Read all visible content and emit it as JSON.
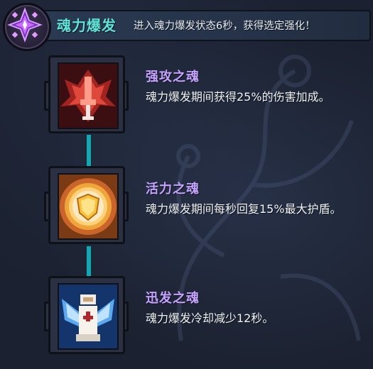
{
  "header": {
    "title": "魂力爆发",
    "subtitle": "进入魂力爆发状态6秒，获得选定强化！",
    "emblem_icon": "purple-crystal-icon"
  },
  "skills": [
    {
      "name": "强攻之魂",
      "description": "魂力爆发期间获得25%的伤害加成。",
      "icon": "red-flame-sword-icon",
      "accent": "#c33a2c"
    },
    {
      "name": "活力之魂",
      "description": "魂力爆发期间每秒回复15%最大护盾。",
      "icon": "golden-shield-icon",
      "accent": "#f0a53a"
    },
    {
      "name": "迅发之魂",
      "description": "魂力爆发冷却减少12秒。",
      "icon": "winged-angel-icon",
      "accent": "#4aa3e8"
    }
  ],
  "colors": {
    "title": "#5fe3d9",
    "skill_name": "#c6a2ff",
    "connector": "#1aa3b0"
  }
}
